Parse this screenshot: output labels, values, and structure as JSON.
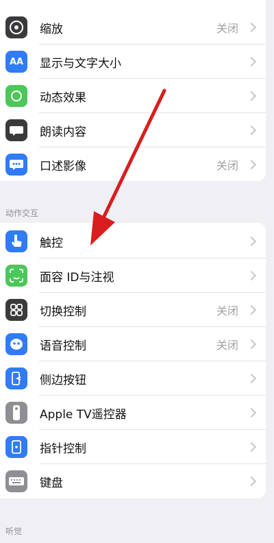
{
  "sections": [
    {
      "header": "",
      "items": [
        {
          "label": "缩放",
          "value": "关闭",
          "icon": "zoom-icon",
          "color": "#3a3a3c"
        },
        {
          "label": "显示与文字大小",
          "value": "",
          "icon": "text-size-icon",
          "color": "#2f7cf6"
        },
        {
          "label": "动态效果",
          "value": "",
          "icon": "motion-icon",
          "color": "#4cc75a"
        },
        {
          "label": "朗读内容",
          "value": "",
          "icon": "spoken-content-icon",
          "color": "#3a3a3c"
        },
        {
          "label": "口述影像",
          "value": "关闭",
          "icon": "audio-description-icon",
          "color": "#2f7cf6"
        }
      ]
    },
    {
      "header": "动作交互",
      "items": [
        {
          "label": "触控",
          "value": "",
          "icon": "touch-icon",
          "color": "#2f7cf6"
        },
        {
          "label": "面容 ID与注视",
          "value": "",
          "icon": "face-id-icon",
          "color": "#4cc75a"
        },
        {
          "label": "切换控制",
          "value": "关闭",
          "icon": "switch-control-icon",
          "color": "#3a3a3c"
        },
        {
          "label": "语音控制",
          "value": "关闭",
          "icon": "voice-control-icon",
          "color": "#2f7cf6"
        },
        {
          "label": "侧边按钮",
          "value": "",
          "icon": "side-button-icon",
          "color": "#2f7cf6"
        },
        {
          "label": "Apple TV遥控器",
          "value": "",
          "icon": "apple-tv-remote-icon",
          "color": "#8e8e93"
        },
        {
          "label": "指针控制",
          "value": "",
          "icon": "pointer-control-icon",
          "color": "#2f7cf6"
        },
        {
          "label": "键盘",
          "value": "",
          "icon": "keyboard-icon",
          "color": "#8e8e93"
        }
      ]
    },
    {
      "header": "听觉",
      "items": []
    }
  ],
  "annotation": {
    "color": "#d81e1e"
  }
}
